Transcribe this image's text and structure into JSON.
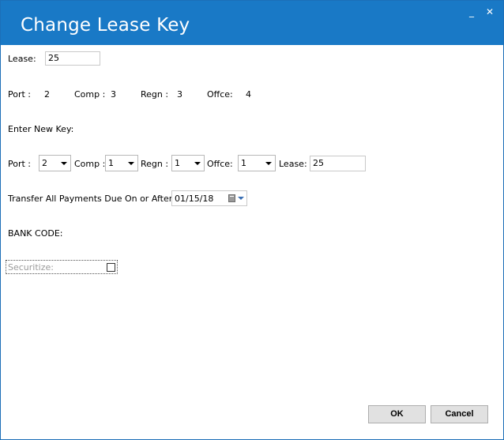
{
  "window": {
    "title": "Change Lease Key",
    "minimize_glyph": "_",
    "close_glyph": "✕"
  },
  "current": {
    "lease_label": "Lease:",
    "lease_value": "25",
    "port_label": "Port :",
    "port_value": "2",
    "comp_label": "Comp :",
    "comp_value": "3",
    "regn_label": "Regn :",
    "regn_value": "3",
    "offce_label": "Offce:",
    "offce_value": "4"
  },
  "new_key": {
    "heading": "Enter New Key:",
    "port_label": "Port :",
    "port_value": "2",
    "comp_label": "Comp :",
    "comp_value": "1",
    "regn_label": "Regn :",
    "regn_value": "1",
    "offce_label": "Offce:",
    "offce_value": "1",
    "lease_label": "Lease:",
    "lease_value": "25"
  },
  "transfer": {
    "label": "Transfer All Payments Due On or After:",
    "date_value": "01/15/18"
  },
  "bank_code": {
    "label": "BANK CODE:"
  },
  "securitize": {
    "label": "Securitize:",
    "checked": false
  },
  "buttons": {
    "ok": "OK",
    "cancel": "Cancel"
  }
}
